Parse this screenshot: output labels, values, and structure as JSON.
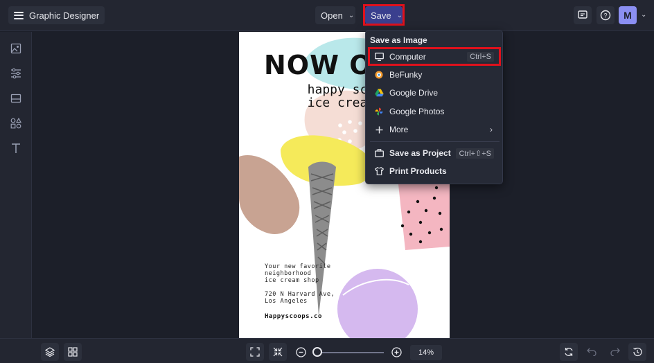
{
  "header": {
    "app_title": "Graphic Designer",
    "open_label": "Open",
    "save_label": "Save",
    "avatar_initial": "M"
  },
  "save_menu": {
    "heading": "Save as Image",
    "items": [
      {
        "label": "Computer",
        "shortcut": "Ctrl+S",
        "icon": "monitor-icon"
      },
      {
        "label": "BeFunky",
        "icon": "befunky-logo-icon"
      },
      {
        "label": "Google Drive",
        "icon": "google-drive-icon"
      },
      {
        "label": "Google Photos",
        "icon": "google-photos-icon"
      },
      {
        "label": "More",
        "icon": "plus-icon"
      }
    ],
    "project_items": [
      {
        "label": "Save as Project",
        "shortcut": "Ctrl+⇧+S",
        "icon": "briefcase-icon"
      },
      {
        "label": "Print Products",
        "icon": "tshirt-icon"
      }
    ]
  },
  "poster": {
    "headline": "NOW O",
    "subline_1": "happy sc",
    "subline_2": "ice crea",
    "body": "Your new favorite\nneighborhood\nice cream shop\n\n720 N Harvard Ave,\nLos Angeles",
    "site": "Happyscoops.co"
  },
  "footer": {
    "zoom_value": "14%",
    "zoom_level_fraction": 0.14
  },
  "colors": {
    "accent": "#3a3f8e",
    "highlight_red": "#e0111c",
    "avatar": "#8b8ff2"
  }
}
